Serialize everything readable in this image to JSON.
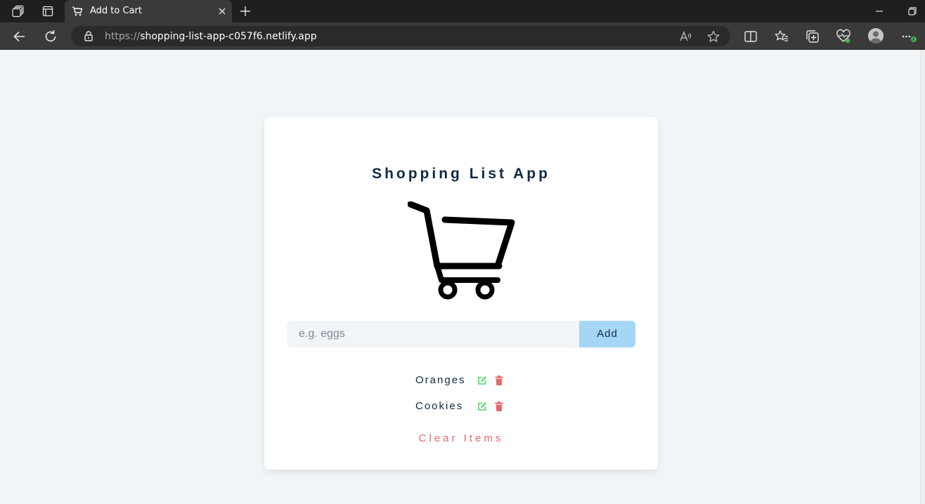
{
  "browser": {
    "tab_title": "Add to Cart",
    "url_scheme": "https://",
    "url_host": "shopping-list-app-c057f6.netlify.app"
  },
  "app": {
    "title": "Shopping List App",
    "input_placeholder": "e.g. eggs",
    "input_value": "",
    "add_label": "Add",
    "items": [
      {
        "name": "Oranges"
      },
      {
        "name": "Cookies"
      }
    ],
    "clear_label": "Clear Items"
  },
  "colors": {
    "title": "#102a43",
    "add_button": "#a6d6f5",
    "edit_icon": "#4cd964",
    "delete_icon": "#e46a6a",
    "clear_text": "#e46a6a",
    "page_bg": "#f1f5f8"
  },
  "icons": {
    "tab_favicon": "shopping-cart-icon",
    "app_illustration": "shopping-cart-icon",
    "item_edit": "edit-icon",
    "item_delete": "trash-icon"
  }
}
